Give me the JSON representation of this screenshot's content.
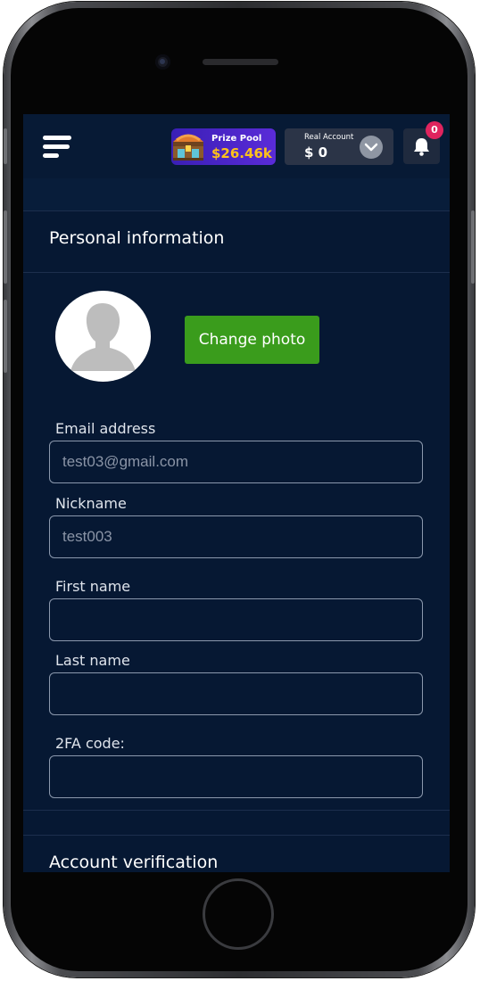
{
  "header": {
    "prize_pool": {
      "title": "Prize Pool",
      "amount": "$26.46k"
    },
    "account": {
      "type": "Real Account",
      "balance": "$ 0"
    },
    "notifications": {
      "count": "0"
    }
  },
  "personal_info": {
    "title": "Personal information",
    "change_photo_label": "Change photo",
    "fields": [
      {
        "label": "Email address",
        "value": "test03@gmail.com"
      },
      {
        "label": "Nickname",
        "value": "test003"
      },
      {
        "label": "First name",
        "value": ""
      },
      {
        "label": "Last name",
        "value": ""
      },
      {
        "label": "2FA code:",
        "value": ""
      }
    ]
  },
  "account_verification": {
    "title": "Account verification"
  },
  "colors": {
    "background": "#061833",
    "header": "#071a35",
    "accent_green": "#3a9c1c",
    "prize_purple": "#4a24c8",
    "prize_gold": "#ffc21a",
    "badge_red": "#e0245e"
  },
  "icons": [
    "hamburger-menu-icon",
    "treasure-chest-icon",
    "chevron-down-icon",
    "bell-icon",
    "avatar-placeholder-icon"
  ]
}
